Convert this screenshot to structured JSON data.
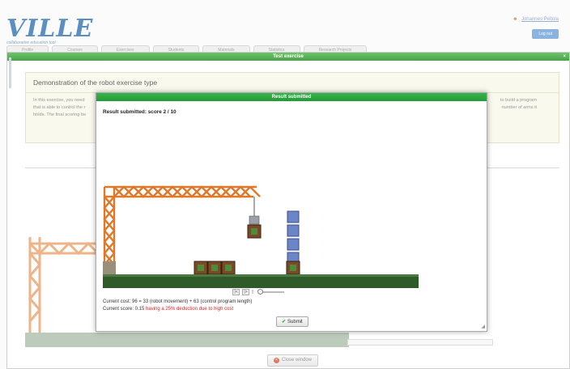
{
  "app": {
    "logo_text": "VILLE",
    "logo_subtitle": "collaborative education tool",
    "user_name": "Johannes Peltola",
    "logout_label": "Log out"
  },
  "main_tabs": [
    {
      "label": "Profile"
    },
    {
      "label": "Courses"
    },
    {
      "label": "Exercises"
    },
    {
      "label": "Students"
    },
    {
      "label": "Materials"
    },
    {
      "label": "Statistics"
    },
    {
      "label": "Research Projects"
    }
  ],
  "outer_dialog": {
    "title": "Test exercise",
    "panel_title": "Demonstration of the robot exercise type",
    "panel_text_left": "In this exercise, you need",
    "panel_text_left2": "that is able to control the r",
    "panel_text_left3": "holds. The final scoring be",
    "panel_text_right": "to build a program",
    "panel_text_right2": "number of arms it",
    "close_window_label": "Close window"
  },
  "result_dialog": {
    "title": "Result submitted",
    "heading": "Result submitted: score 2 / 10",
    "cost_line": "Current cost: 96 = 33 (robot movement) + 63 (control program length)",
    "score_prefix": "Current score: 0.15 ",
    "score_warning": "having a 25% deduction due to high cost",
    "submit_label": "Submit",
    "controls": {
      "first_label": "|<",
      "prev_label": "|>",
      "separator": "||",
      "playback_position": 0
    }
  },
  "scene": {
    "crane_color": "#e0782a",
    "ground_color": "#2f5a2a",
    "box_color": "#7a4a26",
    "block_color": "#6a86c8"
  }
}
